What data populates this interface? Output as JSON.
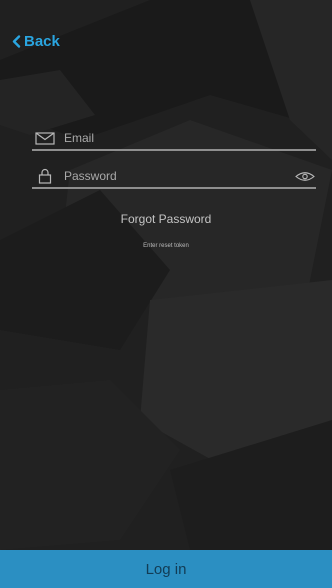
{
  "header": {
    "back_label": "Back"
  },
  "form": {
    "email_placeholder": "Email",
    "email_value": "",
    "password_placeholder": "Password",
    "password_value": "",
    "forgot_label": "Forgot Password",
    "reset_label": "Enter reset token"
  },
  "footer": {
    "login_label": "Log in"
  },
  "colors": {
    "accent": "#2aa5e0",
    "login_bar": "#2b8fc2",
    "background": "#1f1f1f"
  },
  "icons": {
    "back": "chevron-left-icon",
    "email": "mail-icon",
    "password": "lock-icon",
    "toggle_visibility": "eye-icon"
  }
}
